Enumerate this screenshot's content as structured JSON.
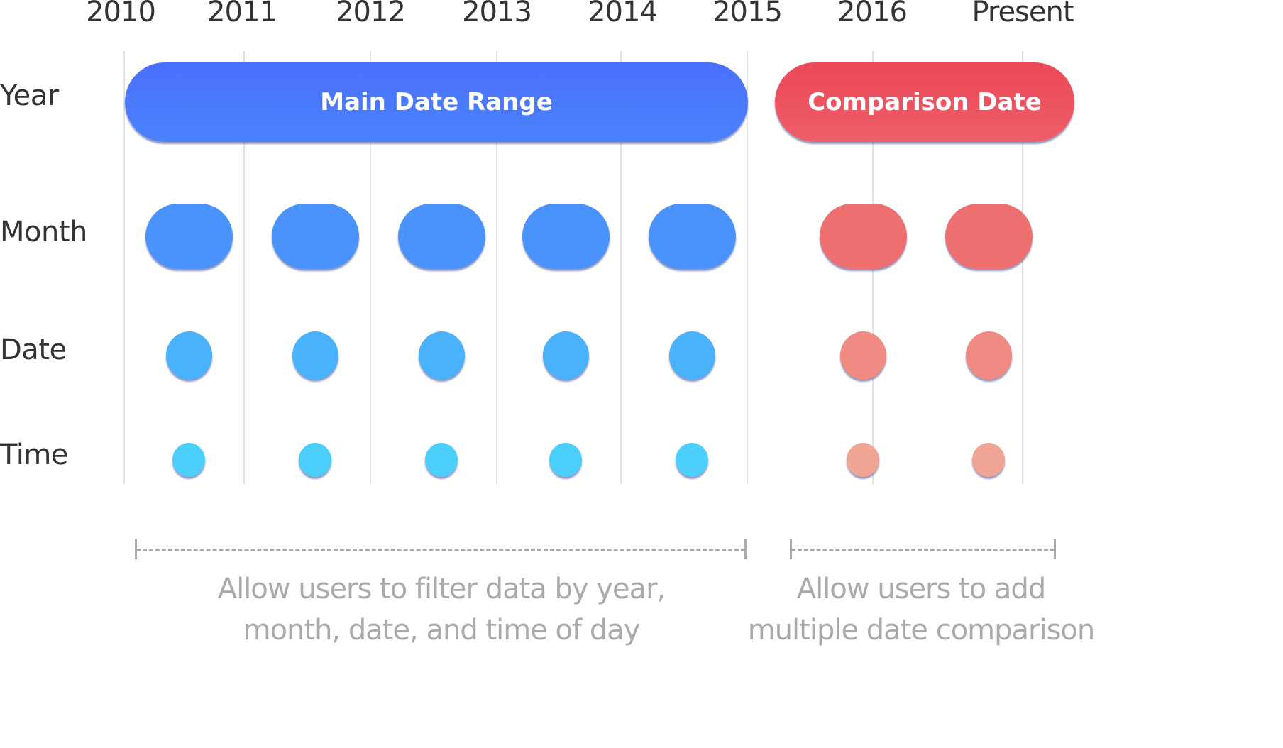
{
  "timeline": {
    "years": [
      "2010",
      "2011",
      "2012",
      "2013",
      "2014",
      "2015",
      "2016",
      "Present"
    ],
    "rows": [
      "Year",
      "Month",
      "Date",
      "Time"
    ]
  },
  "main_range": {
    "label": "Main Date Range",
    "color_start": "#4a70fd",
    "color_end": "#4a82fb",
    "month_color": "#4a93fc",
    "date_color": "#4ab2fc",
    "time_color": "#4dcffc",
    "month_count": 5,
    "caption_line1": "Allow users to filter data by year,",
    "caption_line2": "month, date, and time of day"
  },
  "comparison": {
    "label": "Comparison Date",
    "color_start": "#eb4858",
    "color_end": "#ee5e68",
    "month_color": "#ed6f70",
    "date_color": "#ef8b83",
    "time_color": "#f0a594",
    "month_count": 2,
    "caption_line1": "Allow users to add",
    "caption_line2": "multiple date comparison"
  }
}
